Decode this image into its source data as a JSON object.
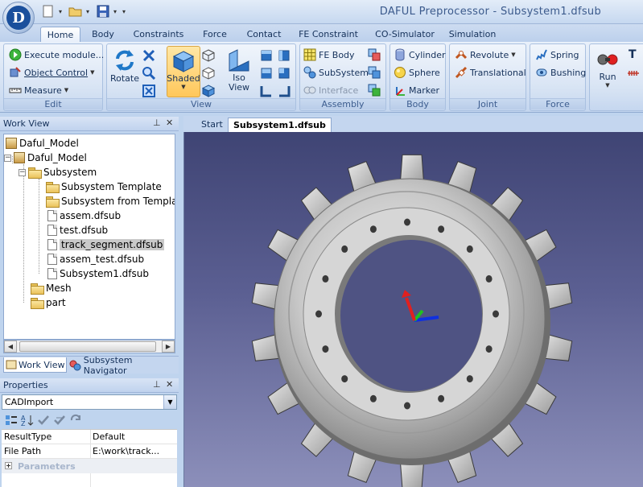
{
  "window": {
    "title": "DAFUL Preprocessor - Subsystem1.dfsub",
    "logo_text": "D"
  },
  "ribbon_tabs": [
    "Home",
    "Body",
    "Constraints",
    "Force",
    "Contact",
    "FE Constraint",
    "CO-Simulator",
    "Simulation"
  ],
  "ribbon": {
    "edit": {
      "label": "Edit",
      "execute_module": "Execute module...",
      "object_control": "Object Control",
      "measure": "Measure"
    },
    "view": {
      "label": "View",
      "rotate": "Rotate",
      "shaded": "Shaded",
      "iso_view_line1": "Iso",
      "iso_view_line2": "View"
    },
    "assembly": {
      "label": "Assembly",
      "fe_body": "FE Body",
      "subsystem": "SubSystem",
      "interface": "Interface"
    },
    "body": {
      "label": "Body",
      "cylinder": "Cylinder",
      "sphere": "Sphere",
      "marker": "Marker"
    },
    "joint": {
      "label": "Joint",
      "revolute": "Revolute",
      "translational": "Translational"
    },
    "force": {
      "label": "Force",
      "spring": "Spring",
      "bushing": "Bushing"
    },
    "simulation": {
      "run": "Run",
      "extra": "T"
    }
  },
  "work_view": {
    "title": "Work View",
    "pin": "⊥",
    "close": "✕",
    "tree": {
      "root": "Daful_Model",
      "model": "Daful_Model",
      "subsystem": "Subsystem",
      "subsystem_items": [
        "Subsystem Template",
        "Subsystem from Template",
        "assem.dfsub",
        "test.dfsub",
        "track_segment.dfsub",
        "assem_test.dfsub",
        "Subsystem1.dfsub"
      ],
      "mesh": "Mesh",
      "part": "part"
    }
  },
  "pane_tabs": {
    "work_view": "Work View",
    "subsystem_navigator": "Subsystem Navigator"
  },
  "properties": {
    "title": "Properties",
    "selected_object": "CADImport",
    "rows": [
      {
        "key": "ResultType",
        "value": "Default"
      },
      {
        "key": "File Path",
        "value": "E:\\work\\track..."
      }
    ],
    "category": "Parameters"
  },
  "document_tabs": {
    "start": "Start",
    "active": "Subsystem1.dfsub"
  },
  "colors": {
    "viewport_top": "#3f4474",
    "viewport_bottom": "#8c8fba",
    "axis_x": "#e02020",
    "axis_y": "#20c020",
    "axis_z": "#1030e0"
  }
}
